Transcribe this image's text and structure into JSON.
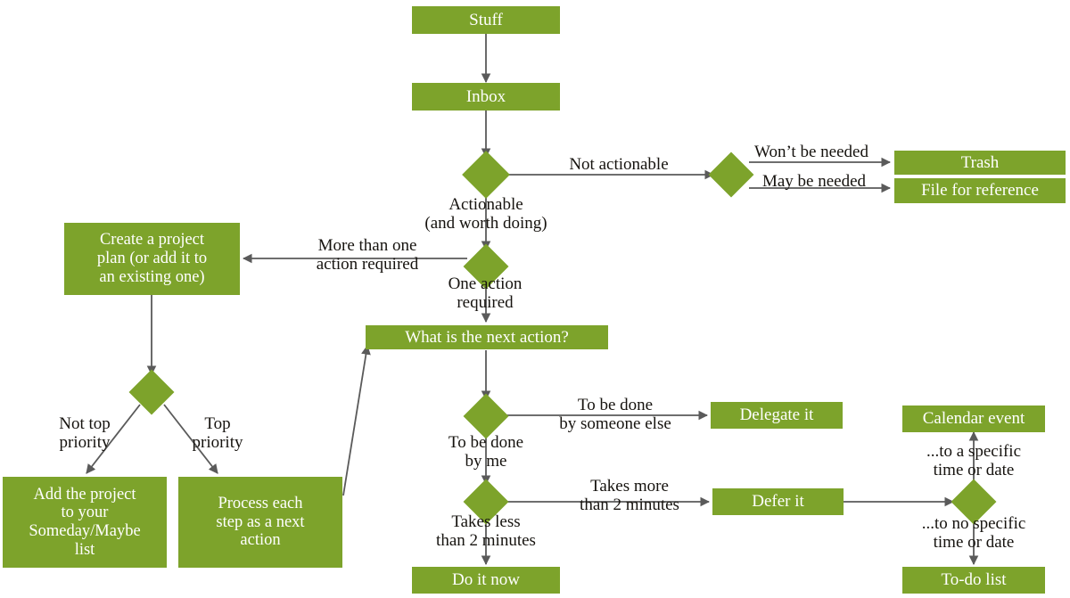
{
  "diagram": {
    "title": "GTD workflow flowchart",
    "colors": {
      "node_fill": "#7DA32B",
      "node_text": "#FFFFFF",
      "label_text": "#16130F",
      "edge_stroke": "#5A5A5A",
      "background": "#FFFFFF"
    },
    "nodes": [
      {
        "id": "stuff",
        "label": "Stuff",
        "shape": "box"
      },
      {
        "id": "inbox",
        "label": "Inbox",
        "shape": "box"
      },
      {
        "id": "d_actionable",
        "label": "",
        "shape": "diamond"
      },
      {
        "id": "d_needed",
        "label": "",
        "shape": "diamond"
      },
      {
        "id": "trash",
        "label": "Trash",
        "shape": "box"
      },
      {
        "id": "file_reference",
        "label": "File for reference",
        "shape": "box"
      },
      {
        "id": "d_actions",
        "label": "",
        "shape": "diamond"
      },
      {
        "id": "project_plan",
        "label": "Create a project\nplan (or add it to\nan existing one)",
        "shape": "box"
      },
      {
        "id": "d_priority",
        "label": "",
        "shape": "diamond"
      },
      {
        "id": "someday_maybe",
        "label": "Add the project\nto your\nSomeday/Maybe\nlist",
        "shape": "box"
      },
      {
        "id": "process_each",
        "label": "Process each\nstep as a next\naction",
        "shape": "box"
      },
      {
        "id": "next_action",
        "label": "What is the next action?",
        "shape": "box"
      },
      {
        "id": "d_who",
        "label": "",
        "shape": "diamond"
      },
      {
        "id": "delegate",
        "label": "Delegate it",
        "shape": "box"
      },
      {
        "id": "d_duration",
        "label": "",
        "shape": "diamond"
      },
      {
        "id": "defer",
        "label": "Defer it",
        "shape": "box"
      },
      {
        "id": "do_it_now",
        "label": "Do it now",
        "shape": "box"
      },
      {
        "id": "d_when",
        "label": "",
        "shape": "diamond"
      },
      {
        "id": "calendar_event",
        "label": "Calendar event",
        "shape": "box"
      },
      {
        "id": "todo_list",
        "label": "To-do list",
        "shape": "box"
      }
    ],
    "edge_labels": [
      {
        "id": "not_actionable",
        "text": "Not actionable"
      },
      {
        "id": "actionable",
        "text": "Actionable\n(and worth doing)"
      },
      {
        "id": "wont_be_needed",
        "text": "Won’t be needed"
      },
      {
        "id": "may_be_needed",
        "text": "May be needed"
      },
      {
        "id": "more_than_one",
        "text": "More than one\naction required"
      },
      {
        "id": "one_action",
        "text": "One action\nrequired"
      },
      {
        "id": "not_top_priority",
        "text": "Not top\npriority"
      },
      {
        "id": "top_priority",
        "text": "Top\npriority"
      },
      {
        "id": "by_someone_else",
        "text": "To be done\nby someone else"
      },
      {
        "id": "by_me",
        "text": "To be done\nby me"
      },
      {
        "id": "takes_more",
        "text": "Takes more\nthan 2 minutes"
      },
      {
        "id": "takes_less",
        "text": "Takes less\nthan 2 minutes"
      },
      {
        "id": "specific_time",
        "text": "...to a specific\ntime or date"
      },
      {
        "id": "no_specific_time",
        "text": "...to no specific\ntime or date"
      }
    ]
  }
}
